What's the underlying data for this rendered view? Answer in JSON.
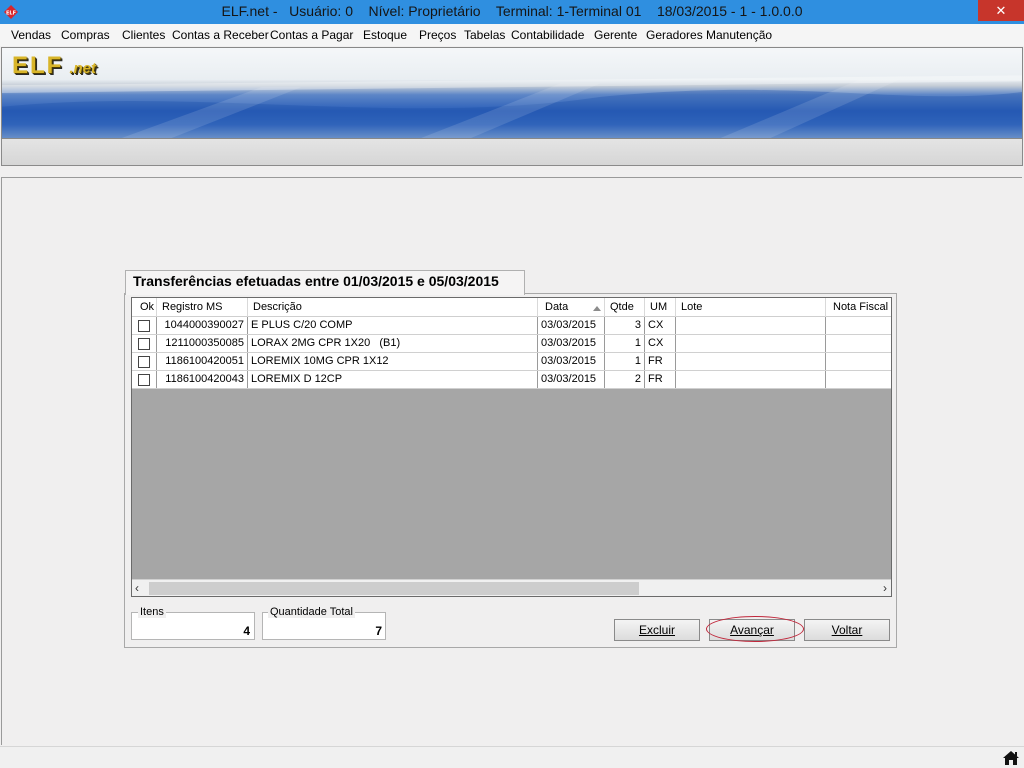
{
  "window": {
    "title": "ELF.net -   Usuário: 0    Nível: Proprietário    Terminal: 1-Terminal 01    18/03/2015 - 1 - 1.0.0.0",
    "close_label": "✕"
  },
  "menu": {
    "items": [
      "Vendas",
      "Compras",
      "Clientes",
      "Contas a Receber",
      "Contas a Pagar",
      "Estoque",
      "Preços",
      "Tabelas",
      "Contabilidade",
      "Gerente",
      "Geradores",
      "Manutenção"
    ]
  },
  "banner": {
    "logo_main": "ELF",
    "logo_sub": ".net"
  },
  "panel": {
    "title": "Transferências efetuadas entre 01/03/2015 e 05/03/2015"
  },
  "grid": {
    "columns": [
      "Ok",
      "Registro MS",
      "Descrição",
      "Data",
      "Qtde",
      "UM",
      "Lote",
      "Nota Fiscal"
    ],
    "rows": [
      {
        "ok": false,
        "registro": "1044000390027",
        "descricao": "E PLUS C/20 COMP",
        "data": "03/03/2015",
        "qtde": "3",
        "um": "CX",
        "lote": "",
        "nota": ""
      },
      {
        "ok": false,
        "registro": "1211000350085",
        "descricao": "LORAX 2MG CPR 1X20   (B1)",
        "data": "03/03/2015",
        "qtde": "1",
        "um": "CX",
        "lote": "",
        "nota": ""
      },
      {
        "ok": false,
        "registro": "1186100420051",
        "descricao": "LOREMIX 10MG CPR 1X12",
        "data": "03/03/2015",
        "qtde": "1",
        "um": "FR",
        "lote": "",
        "nota": ""
      },
      {
        "ok": false,
        "registro": "1186100420043",
        "descricao": "LOREMIX D 12CP",
        "data": "03/03/2015",
        "qtde": "2",
        "um": "FR",
        "lote": "",
        "nota": ""
      }
    ],
    "scroll_left": "‹",
    "scroll_right": "›"
  },
  "summary": {
    "itens_label": "Itens",
    "itens_value": "4",
    "quantidade_label": "Quantidade Total",
    "quantidade_value": "7"
  },
  "buttons": {
    "excluir": "Excluir",
    "avancar": "Avançar",
    "voltar": "Voltar"
  },
  "colors": {
    "titlebar": "#2f8fe0",
    "close": "#c7352b",
    "highlight_ring": "#c0273b"
  },
  "icons": {
    "app": "elf-logo-icon",
    "home": "home-icon"
  }
}
